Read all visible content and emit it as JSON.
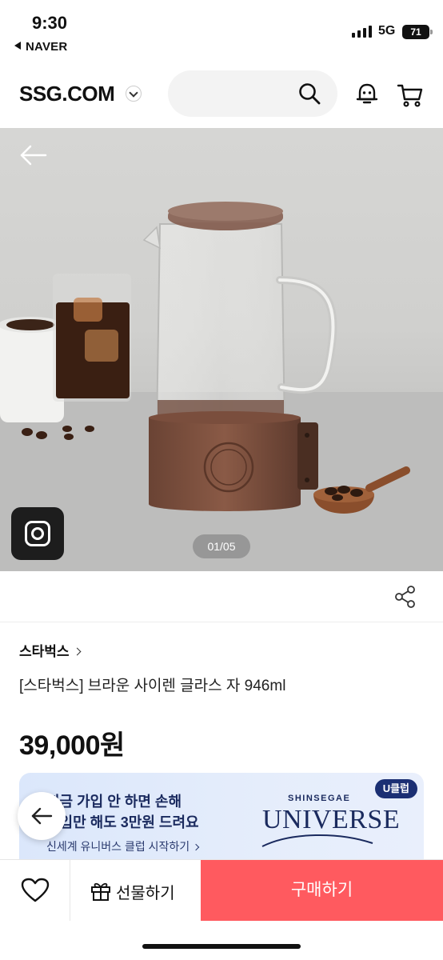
{
  "status_bar": {
    "time": "9:30",
    "back_app": "NAVER",
    "network": "5G",
    "battery": "71"
  },
  "header": {
    "logo": "SSG.COM",
    "icons": [
      "chevron-down-icon",
      "search-icon",
      "notification-bell-icon",
      "cart-icon"
    ]
  },
  "gallery": {
    "pager": "01/05",
    "icons": [
      "back-arrow-icon",
      "instagram-icon"
    ]
  },
  "product": {
    "brand": "스타벅스",
    "title": "[스타벅스] 브라운 사이렌 글라스 자 946ml",
    "price": "39,000원"
  },
  "banner": {
    "line1": "지금 가입 안 하면 손해",
    "line2": "가입만 해도 3만원 드려요",
    "cta": "신세계 유니버스 클럽 시작하기",
    "badge": "U클럽",
    "brand_top": "SHINSEGAE",
    "brand_main": "UNIVERSE",
    "accent_color": "#1a2a5e"
  },
  "bottom_bar": {
    "gift_label": "선물하기",
    "buy_label": "구매하기",
    "buy_color": "#ff5a5f"
  }
}
